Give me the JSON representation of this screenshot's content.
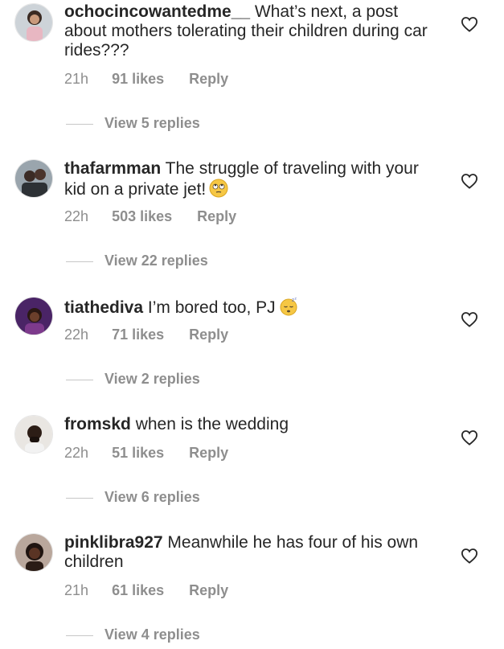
{
  "comments": [
    {
      "username": "ochocincowantedme__",
      "text": "What’s next, a post about mothers tolerating their children during car rides???",
      "time": "21h",
      "likes": "91 likes",
      "reply_label": "Reply",
      "view_replies": "View 5 replies"
    },
    {
      "username": "thafarmman",
      "text": "The struggle of traveling with your kid on a private jet!",
      "emoji": "eye-roll-emoji",
      "time": "22h",
      "likes": "503 likes",
      "reply_label": "Reply",
      "view_replies": "View 22 replies"
    },
    {
      "username": "tiathediva",
      "text": "I’m bored too, PJ",
      "emoji": "sleeping-emoji",
      "time": "22h",
      "likes": "71 likes",
      "reply_label": "Reply",
      "view_replies": "View 2 replies"
    },
    {
      "username": "fromskd",
      "text": "when is the wedding",
      "time": "22h",
      "likes": "51 likes",
      "reply_label": "Reply",
      "view_replies": "View 6 replies"
    },
    {
      "username": "pinklibra927",
      "text": "Meanwhile he has four of his own children",
      "time": "21h",
      "likes": "61 likes",
      "reply_label": "Reply",
      "view_replies": "View 4 replies"
    }
  ],
  "icons": {
    "like": "heart-outline-icon"
  },
  "colors": {
    "text": "#262626",
    "secondary": "#8e8e8e",
    "divider": "#c7c7c7"
  }
}
